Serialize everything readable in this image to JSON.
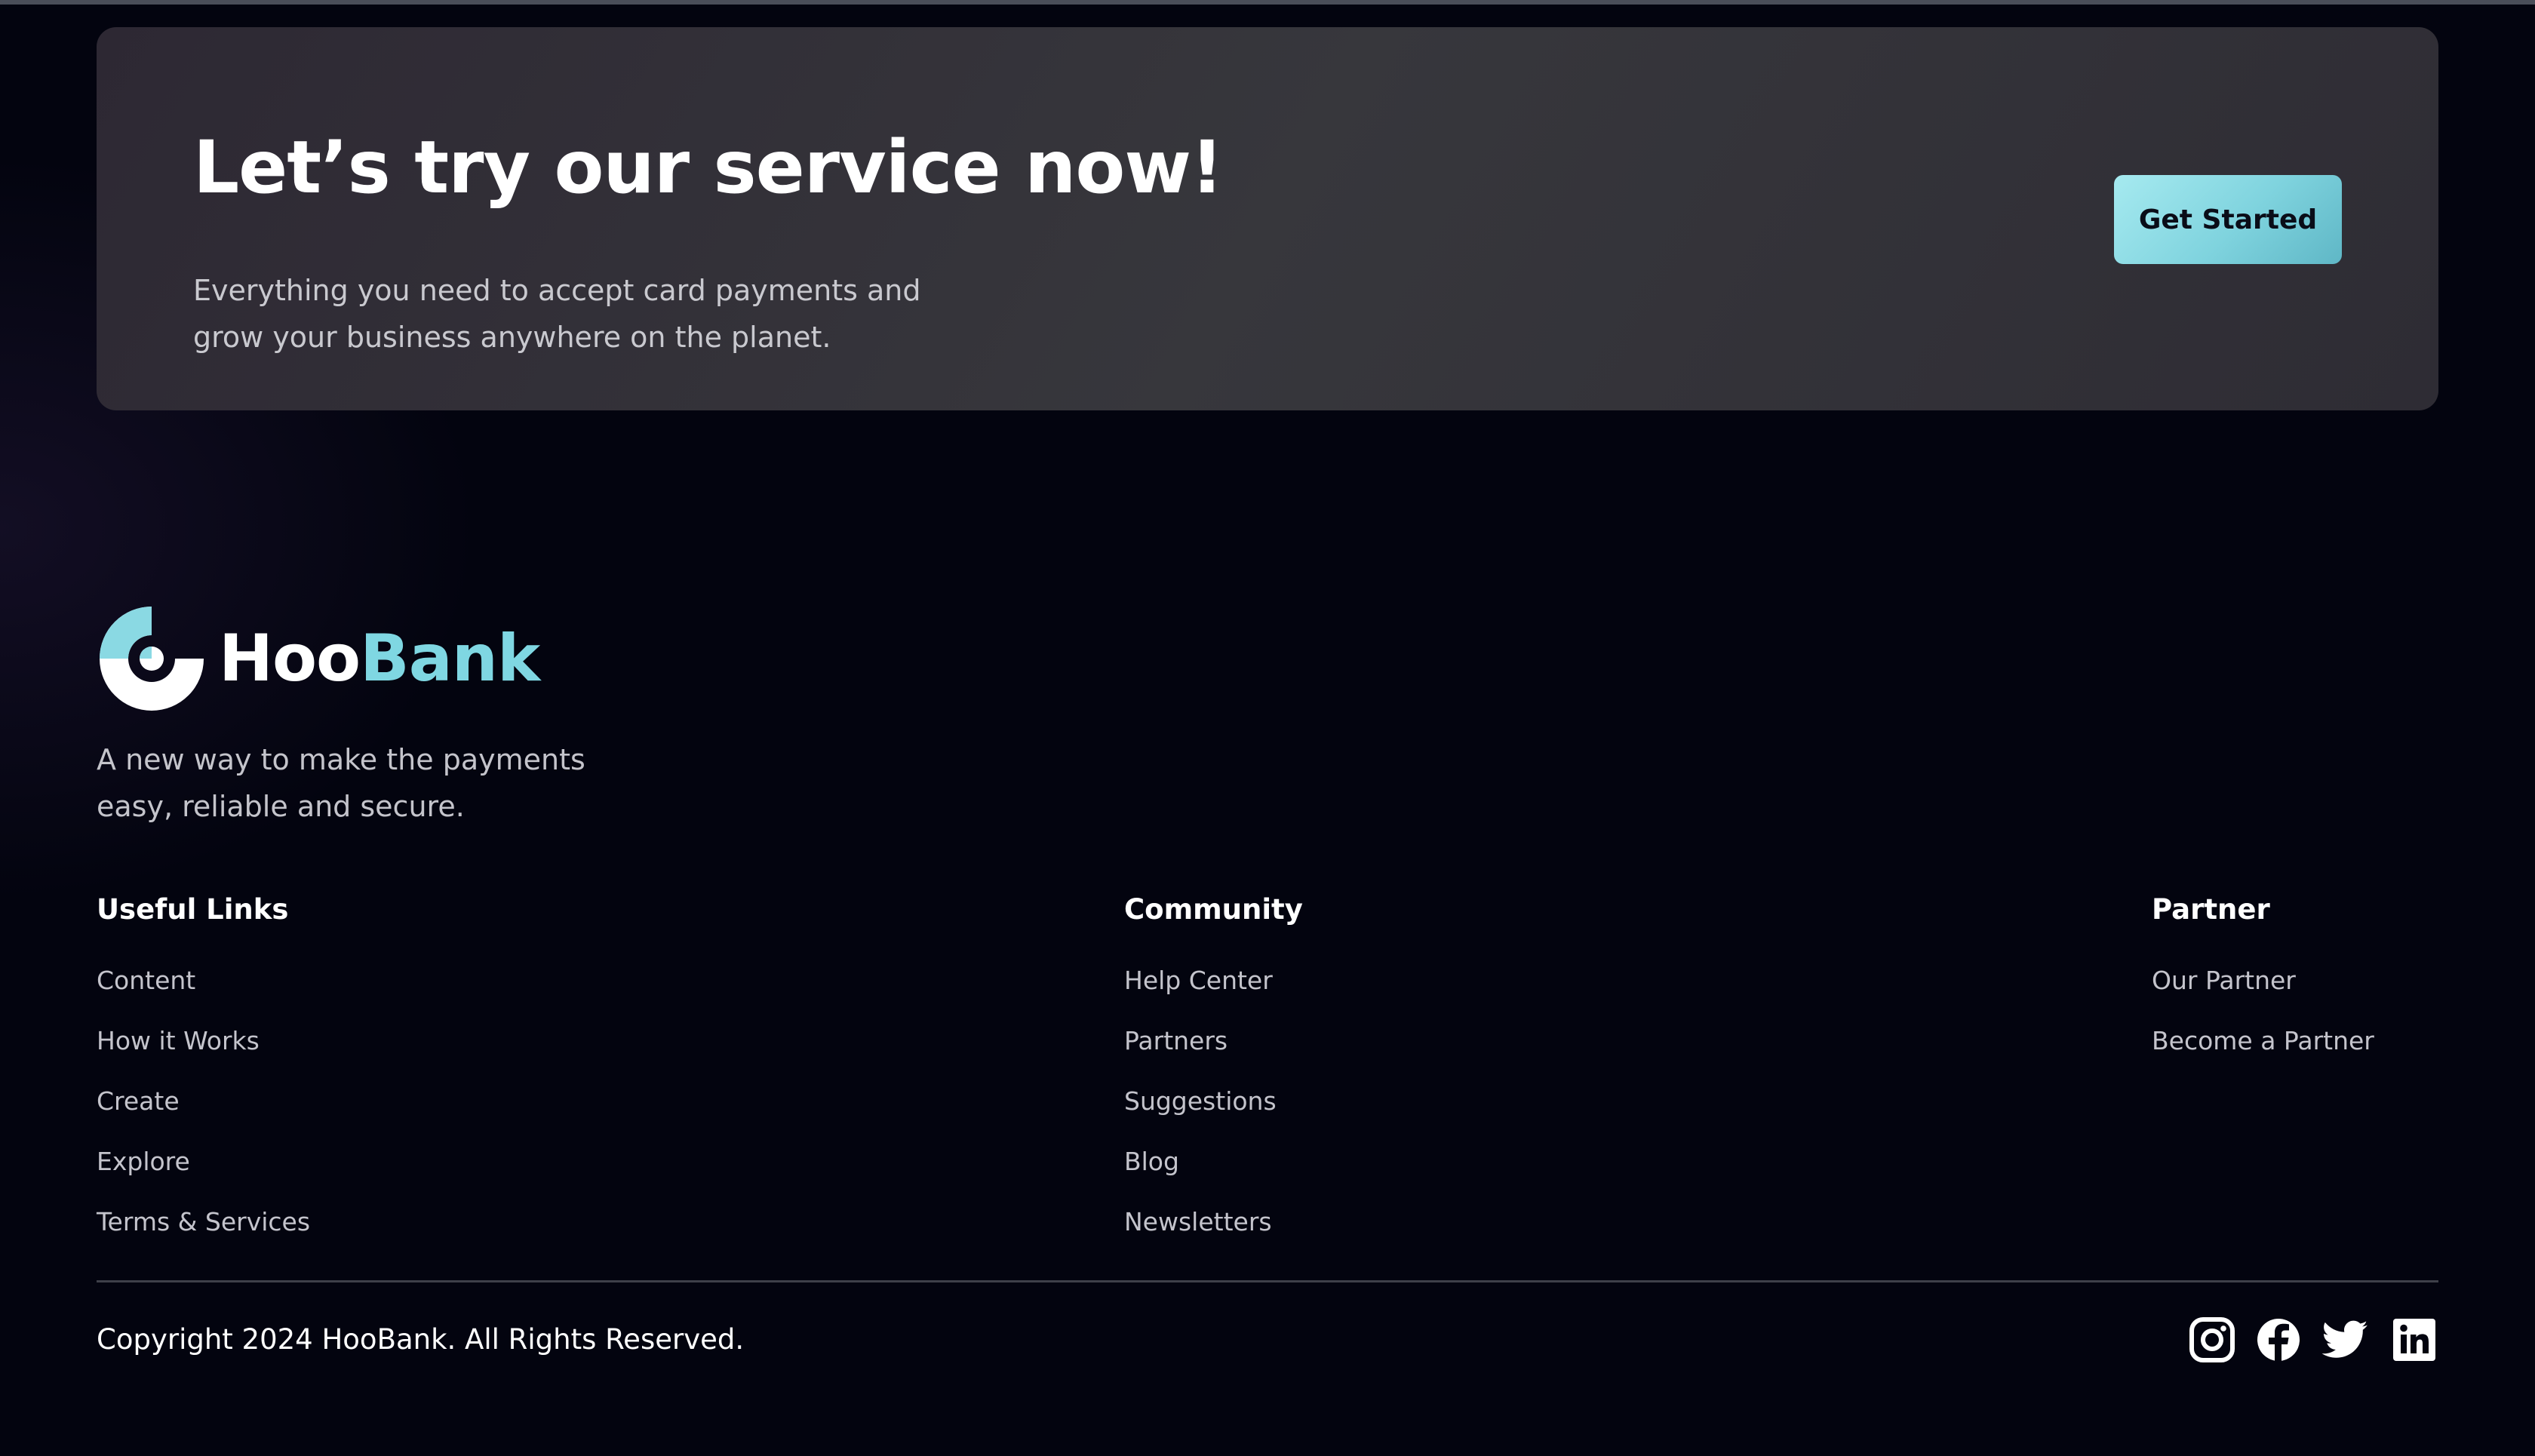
{
  "cta": {
    "title": "Let’s try our service now!",
    "description_line1": "Everything you need to accept card payments and",
    "description_line2": "grow your business anywhere on the planet.",
    "button_label": "Get Started"
  },
  "brand": {
    "name_part1": "Hoo",
    "name_part2": "Bank",
    "tagline_line1": "A new way to make the payments",
    "tagline_line2": "easy, reliable and secure.",
    "accent_color": "#7fd7e2"
  },
  "footer": {
    "columns": [
      {
        "heading": "Useful Links",
        "links": [
          "Content",
          "How it Works",
          "Create",
          "Explore",
          "Terms & Services"
        ]
      },
      {
        "heading": "Community",
        "links": [
          "Help Center",
          "Partners",
          "Suggestions",
          "Blog",
          "Newsletters"
        ]
      },
      {
        "heading": "Partner",
        "links": [
          "Our Partner",
          "Become a Partner"
        ]
      }
    ],
    "copyright": "Copyright 2024 HooBank. All Rights Reserved.",
    "social_icons": [
      "instagram-icon",
      "facebook-icon",
      "twitter-icon",
      "linkedin-icon"
    ]
  }
}
